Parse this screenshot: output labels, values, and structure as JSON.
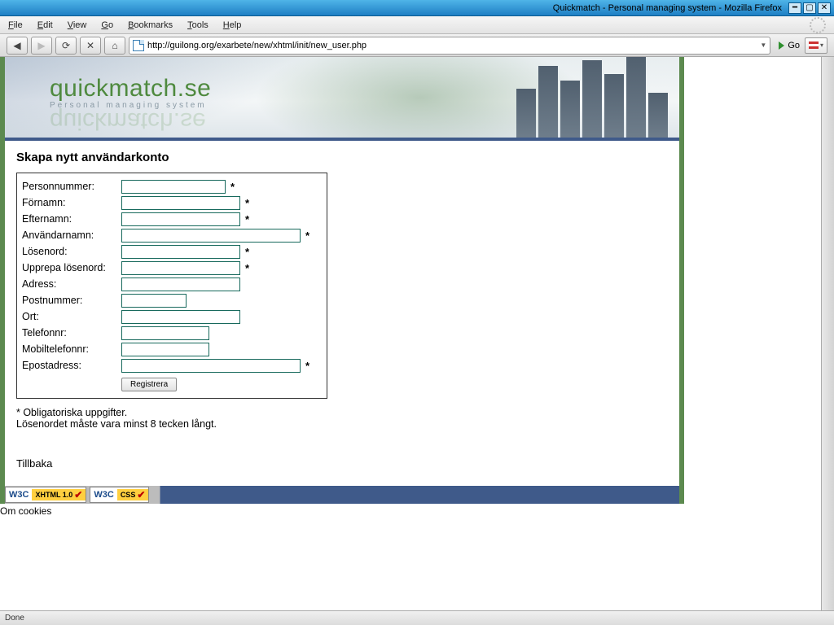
{
  "window": {
    "title": "Quickmatch - Personal managing system - Mozilla Firefox"
  },
  "menubar": {
    "file": "File",
    "edit": "Edit",
    "view": "View",
    "go": "Go",
    "bookmarks": "Bookmarks",
    "tools": "Tools",
    "help": "Help"
  },
  "toolbar": {
    "url": "http://guilong.org/exarbete/new/xhtml/init/new_user.php",
    "go_label": "Go"
  },
  "site": {
    "logo_name": "quickmatch.se",
    "logo_sub": "Personal managing system"
  },
  "form": {
    "heading": "Skapa nytt användarkonto",
    "fields": {
      "ssn": "Personnummer:",
      "firstname": "Förnamn:",
      "lastname": "Efternamn:",
      "username": "Användarnamn:",
      "password": "Lösenord:",
      "password2": "Upprepa lösenord:",
      "address": "Adress:",
      "zip": "Postnummer:",
      "city": "Ort:",
      "phone": "Telefonnr:",
      "mobile": "Mobiltelefonnr:",
      "email": "Epostadress:"
    },
    "star": "*",
    "submit": "Registrera",
    "note1": "*  Obligatoriska uppgifter.",
    "note2": "Lösenordet måste vara minst 8 tecken långt.",
    "back": "Tillbaka"
  },
  "badges": {
    "w3c": "W3C",
    "xhtml": "XHTML 1.0",
    "css": "CSS"
  },
  "footer": {
    "cookies": "Om cookies"
  },
  "status": {
    "text": "Done"
  }
}
